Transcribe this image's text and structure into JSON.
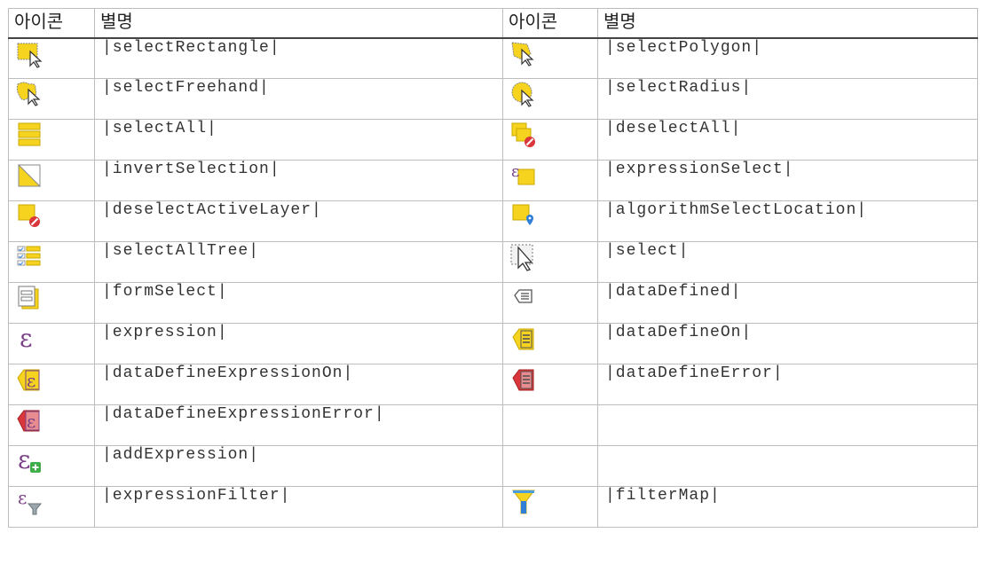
{
  "header": {
    "icon_col": "아이콘",
    "alias_col": "별명"
  },
  "rows": [
    {
      "left": "|selectRectangle|",
      "right": "|selectPolygon|"
    },
    {
      "left": "|selectFreehand|",
      "right": "|selectRadius|"
    },
    {
      "left": "|selectAll|",
      "right": "|deselectAll|"
    },
    {
      "left": "|invertSelection|",
      "right": "|expressionSelect|"
    },
    {
      "left": "|deselectActiveLayer|",
      "right": "|algorithmSelectLocation|"
    },
    {
      "left": "|selectAllTree|",
      "right": "|select|"
    },
    {
      "left": "|formSelect|",
      "right": "|dataDefined|"
    },
    {
      "left": "|expression|",
      "right": "|dataDefineOn|"
    },
    {
      "left": "|dataDefineExpressionOn|",
      "right": "|dataDefineError|"
    },
    {
      "left": "|dataDefineExpressionError|",
      "right": ""
    },
    {
      "left": "|addExpression|",
      "right": ""
    },
    {
      "left": "|expressionFilter|",
      "right": "|filterMap|"
    }
  ],
  "icons": {
    "left": [
      "select-rectangle-icon",
      "select-freehand-icon",
      "select-all-icon",
      "invert-selection-icon",
      "deselect-active-layer-icon",
      "select-all-tree-icon",
      "form-select-icon",
      "expression-icon",
      "data-define-expression-on-icon",
      "data-define-expression-error-icon",
      "add-expression-icon",
      "expression-filter-icon"
    ],
    "right": [
      "select-polygon-icon",
      "select-radius-icon",
      "deselect-all-icon",
      "expression-select-icon",
      "algorithm-select-location-icon",
      "select-icon",
      "data-defined-icon",
      "data-define-on-icon",
      "data-define-error-icon",
      "",
      "",
      "filter-map-icon"
    ]
  },
  "colors": {
    "yellow": "#f5d31f",
    "red": "#d9373c",
    "purple": "#7a3f86",
    "green": "#3fae49",
    "blue": "#2f7fd8"
  }
}
